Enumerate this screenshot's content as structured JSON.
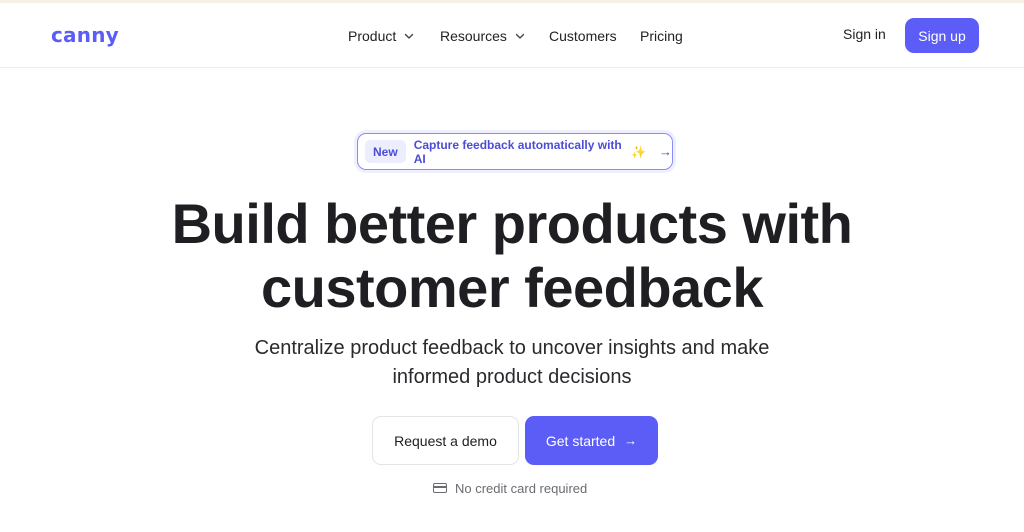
{
  "brand": {
    "logo_text": "canny",
    "accent": "#5b5df6"
  },
  "nav": {
    "items": [
      {
        "label": "Product",
        "has_dropdown": true,
        "icon": "chevron-down-icon"
      },
      {
        "label": "Resources",
        "has_dropdown": true,
        "icon": "chevron-down-icon"
      },
      {
        "label": "Customers",
        "has_dropdown": false
      },
      {
        "label": "Pricing",
        "has_dropdown": false
      }
    ],
    "sign_in": "Sign in",
    "sign_up": "Sign up"
  },
  "hero": {
    "badge": {
      "tag": "New",
      "text": "Capture feedback automatically with AI",
      "spark_icon": "sparkle-icon",
      "arrow": "→"
    },
    "headline_line1": "Build better products with",
    "headline_line2": "customer feedback",
    "subhead_line1": "Centralize product feedback to uncover insights and make",
    "subhead_line2": "informed product decisions",
    "cta_secondary": "Request a demo",
    "cta_primary": "Get started",
    "cta_primary_arrow": "→",
    "note": "No credit card required",
    "note_icon": "credit-card-icon"
  }
}
